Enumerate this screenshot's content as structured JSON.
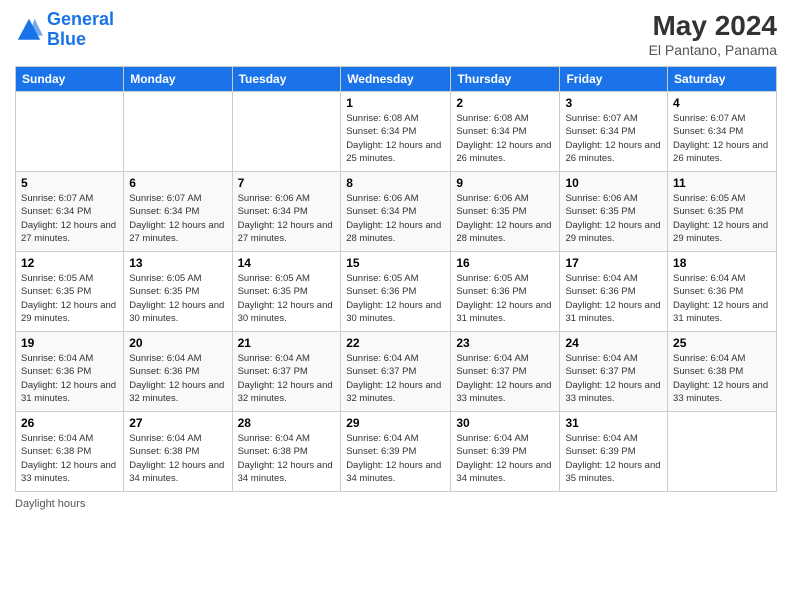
{
  "header": {
    "logo_line1": "General",
    "logo_line2": "Blue",
    "month_title": "May 2024",
    "subtitle": "El Pantano, Panama"
  },
  "days_of_week": [
    "Sunday",
    "Monday",
    "Tuesday",
    "Wednesday",
    "Thursday",
    "Friday",
    "Saturday"
  ],
  "weeks": [
    [
      {
        "day": "",
        "info": ""
      },
      {
        "day": "",
        "info": ""
      },
      {
        "day": "",
        "info": ""
      },
      {
        "day": "1",
        "info": "Sunrise: 6:08 AM\nSunset: 6:34 PM\nDaylight: 12 hours and 25 minutes."
      },
      {
        "day": "2",
        "info": "Sunrise: 6:08 AM\nSunset: 6:34 PM\nDaylight: 12 hours and 26 minutes."
      },
      {
        "day": "3",
        "info": "Sunrise: 6:07 AM\nSunset: 6:34 PM\nDaylight: 12 hours and 26 minutes."
      },
      {
        "day": "4",
        "info": "Sunrise: 6:07 AM\nSunset: 6:34 PM\nDaylight: 12 hours and 26 minutes."
      }
    ],
    [
      {
        "day": "5",
        "info": "Sunrise: 6:07 AM\nSunset: 6:34 PM\nDaylight: 12 hours and 27 minutes."
      },
      {
        "day": "6",
        "info": "Sunrise: 6:07 AM\nSunset: 6:34 PM\nDaylight: 12 hours and 27 minutes."
      },
      {
        "day": "7",
        "info": "Sunrise: 6:06 AM\nSunset: 6:34 PM\nDaylight: 12 hours and 27 minutes."
      },
      {
        "day": "8",
        "info": "Sunrise: 6:06 AM\nSunset: 6:34 PM\nDaylight: 12 hours and 28 minutes."
      },
      {
        "day": "9",
        "info": "Sunrise: 6:06 AM\nSunset: 6:35 PM\nDaylight: 12 hours and 28 minutes."
      },
      {
        "day": "10",
        "info": "Sunrise: 6:06 AM\nSunset: 6:35 PM\nDaylight: 12 hours and 29 minutes."
      },
      {
        "day": "11",
        "info": "Sunrise: 6:05 AM\nSunset: 6:35 PM\nDaylight: 12 hours and 29 minutes."
      }
    ],
    [
      {
        "day": "12",
        "info": "Sunrise: 6:05 AM\nSunset: 6:35 PM\nDaylight: 12 hours and 29 minutes."
      },
      {
        "day": "13",
        "info": "Sunrise: 6:05 AM\nSunset: 6:35 PM\nDaylight: 12 hours and 30 minutes."
      },
      {
        "day": "14",
        "info": "Sunrise: 6:05 AM\nSunset: 6:35 PM\nDaylight: 12 hours and 30 minutes."
      },
      {
        "day": "15",
        "info": "Sunrise: 6:05 AM\nSunset: 6:36 PM\nDaylight: 12 hours and 30 minutes."
      },
      {
        "day": "16",
        "info": "Sunrise: 6:05 AM\nSunset: 6:36 PM\nDaylight: 12 hours and 31 minutes."
      },
      {
        "day": "17",
        "info": "Sunrise: 6:04 AM\nSunset: 6:36 PM\nDaylight: 12 hours and 31 minutes."
      },
      {
        "day": "18",
        "info": "Sunrise: 6:04 AM\nSunset: 6:36 PM\nDaylight: 12 hours and 31 minutes."
      }
    ],
    [
      {
        "day": "19",
        "info": "Sunrise: 6:04 AM\nSunset: 6:36 PM\nDaylight: 12 hours and 31 minutes."
      },
      {
        "day": "20",
        "info": "Sunrise: 6:04 AM\nSunset: 6:36 PM\nDaylight: 12 hours and 32 minutes."
      },
      {
        "day": "21",
        "info": "Sunrise: 6:04 AM\nSunset: 6:37 PM\nDaylight: 12 hours and 32 minutes."
      },
      {
        "day": "22",
        "info": "Sunrise: 6:04 AM\nSunset: 6:37 PM\nDaylight: 12 hours and 32 minutes."
      },
      {
        "day": "23",
        "info": "Sunrise: 6:04 AM\nSunset: 6:37 PM\nDaylight: 12 hours and 33 minutes."
      },
      {
        "day": "24",
        "info": "Sunrise: 6:04 AM\nSunset: 6:37 PM\nDaylight: 12 hours and 33 minutes."
      },
      {
        "day": "25",
        "info": "Sunrise: 6:04 AM\nSunset: 6:38 PM\nDaylight: 12 hours and 33 minutes."
      }
    ],
    [
      {
        "day": "26",
        "info": "Sunrise: 6:04 AM\nSunset: 6:38 PM\nDaylight: 12 hours and 33 minutes."
      },
      {
        "day": "27",
        "info": "Sunrise: 6:04 AM\nSunset: 6:38 PM\nDaylight: 12 hours and 34 minutes."
      },
      {
        "day": "28",
        "info": "Sunrise: 6:04 AM\nSunset: 6:38 PM\nDaylight: 12 hours and 34 minutes."
      },
      {
        "day": "29",
        "info": "Sunrise: 6:04 AM\nSunset: 6:39 PM\nDaylight: 12 hours and 34 minutes."
      },
      {
        "day": "30",
        "info": "Sunrise: 6:04 AM\nSunset: 6:39 PM\nDaylight: 12 hours and 34 minutes."
      },
      {
        "day": "31",
        "info": "Sunrise: 6:04 AM\nSunset: 6:39 PM\nDaylight: 12 hours and 35 minutes."
      },
      {
        "day": "",
        "info": ""
      }
    ]
  ],
  "footer": {
    "daylight_label": "Daylight hours"
  }
}
